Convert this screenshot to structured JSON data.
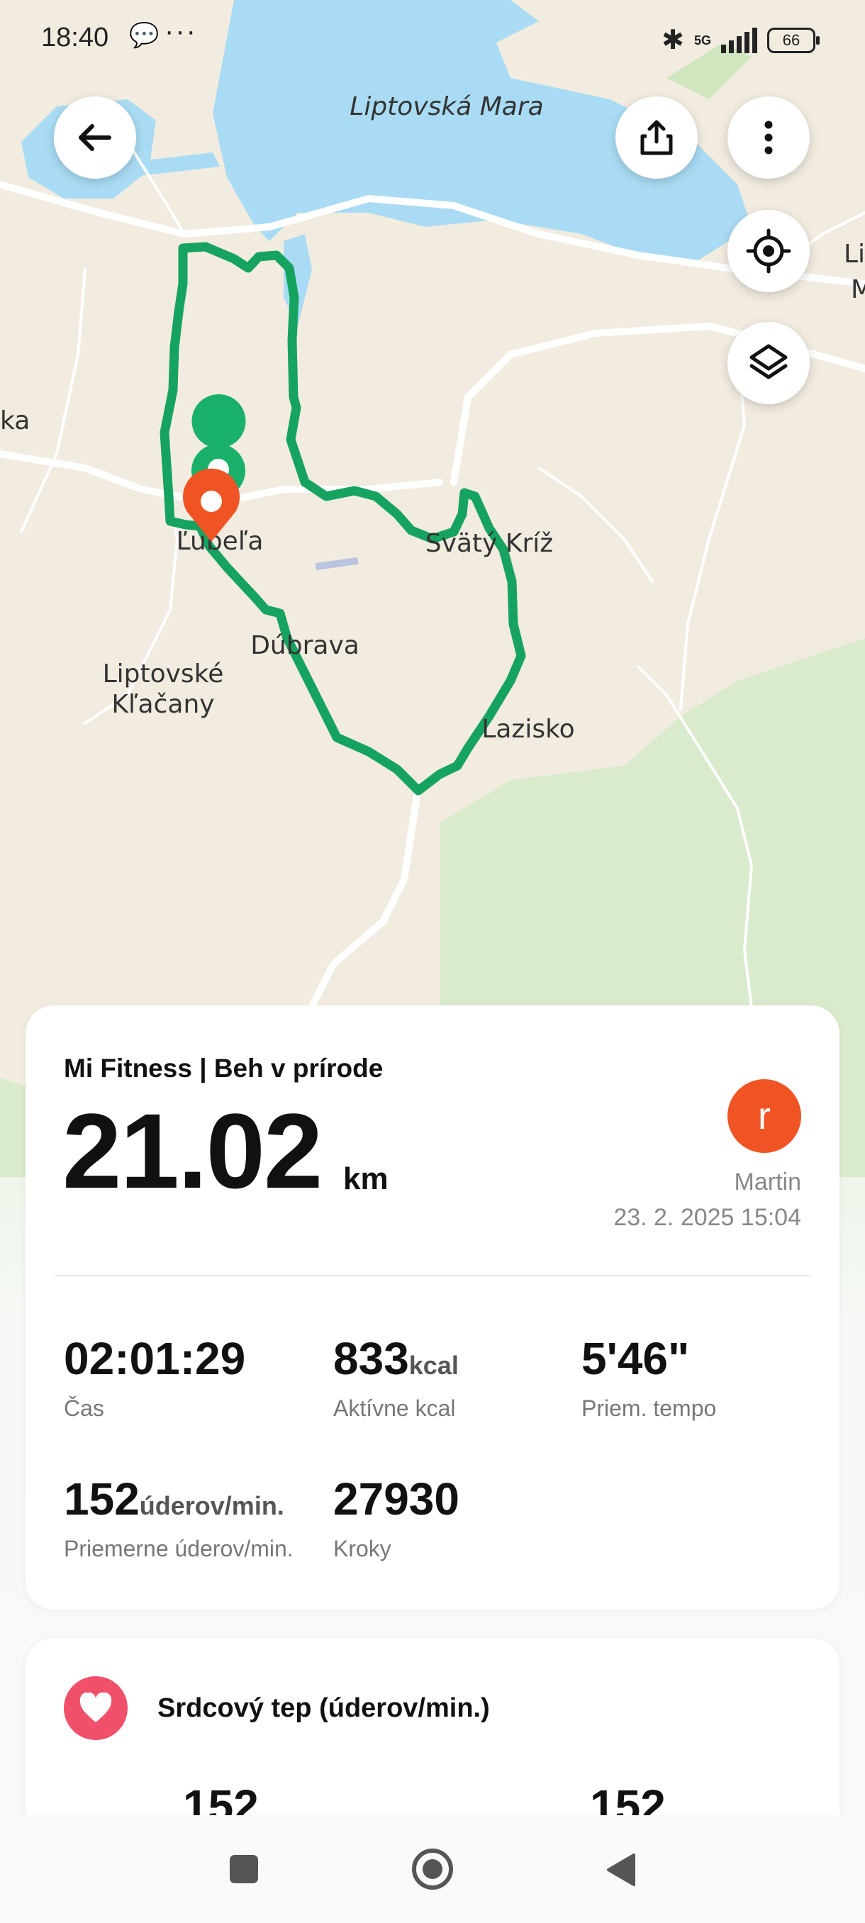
{
  "status_bar": {
    "time": "18:40",
    "network": "5G",
    "battery": "66"
  },
  "map": {
    "labels": {
      "lake": "Liptovská Mara",
      "lubela": "Ľubeľa",
      "svaty_kriz": "Svätý Kríž",
      "dubrava": "Dúbrava",
      "klacany_1": "Liptovské",
      "klacany_2": "Kľačany",
      "lazisko": "Lazisko",
      "partial_left": "ka",
      "partial_right_1": "Li",
      "partial_right_2": "M"
    },
    "colors": {
      "route": "#16a35f",
      "water": "#a9dcf4",
      "land": "#f2ece0",
      "forest": "#d9ebcc",
      "start_pin": "#19b06a",
      "end_pin": "#f05424"
    }
  },
  "summary": {
    "sport_title": "Mi Fitness | Beh v prírode",
    "distance": "21.02",
    "distance_unit": "km",
    "avatar_letter": "r",
    "user_name": "Martin",
    "date": "23. 2. 2025 15:04",
    "stats": [
      {
        "value": "02:01:29",
        "unit": "",
        "label": "Čas"
      },
      {
        "value": "833",
        "unit": "kcal",
        "label": "Aktívne kcal"
      },
      {
        "value": "5'46\"",
        "unit": "",
        "label": "Priem. tempo"
      },
      {
        "value": "152",
        "unit": "úderov/min.",
        "label": "Priemerne úderov/min."
      },
      {
        "value": "27930",
        "unit": "",
        "label": "Kroky"
      }
    ]
  },
  "heart_rate": {
    "title": "Srdcový tep (úderov/min.)",
    "left_value": "152",
    "right_value": "152"
  }
}
